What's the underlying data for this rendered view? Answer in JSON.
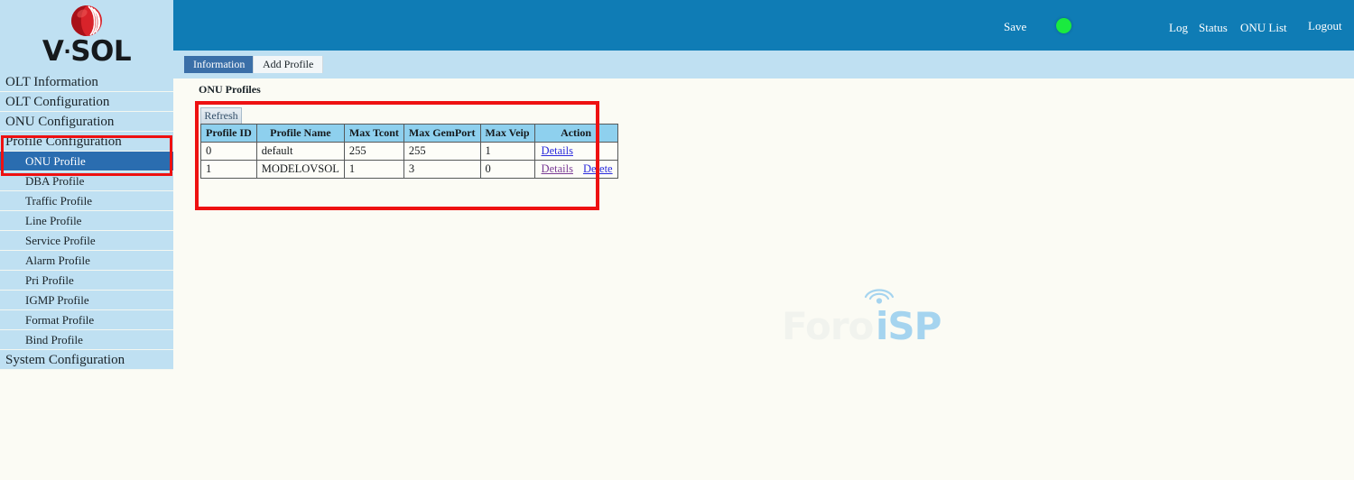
{
  "brand": {
    "logo_text_v": "V",
    "logo_text_dot": "·",
    "logo_text_sol": "SOL",
    "logo_icon": "vsol-sphere-logo",
    "logo_color": "#d8232a"
  },
  "topbar": {
    "background": "#0f7cb5",
    "save_label": "Save",
    "status_led": "green-status-led",
    "status_led_color": "#1aea3f",
    "log_label": "Log",
    "status_label": "Status",
    "onu_list_label": "ONU List",
    "logout_label": "Logout"
  },
  "tabs": [
    {
      "label": "Information",
      "active": true
    },
    {
      "label": "Add Profile",
      "active": false
    }
  ],
  "sidebar": {
    "items": [
      {
        "label": "OLT Information",
        "level": "top",
        "active": false
      },
      {
        "label": "OLT Configuration",
        "level": "top",
        "active": false
      },
      {
        "label": "ONU Configuration",
        "level": "top",
        "active": false
      },
      {
        "label": "Profile Configuration",
        "level": "top",
        "active": false
      },
      {
        "label": "ONU Profile",
        "level": "sub",
        "active": true
      },
      {
        "label": "DBA Profile",
        "level": "sub",
        "active": false
      },
      {
        "label": "Traffic Profile",
        "level": "sub",
        "active": false
      },
      {
        "label": "Line Profile",
        "level": "sub",
        "active": false
      },
      {
        "label": "Service Profile",
        "level": "sub",
        "active": false
      },
      {
        "label": "Alarm Profile",
        "level": "sub",
        "active": false
      },
      {
        "label": "Pri Profile",
        "level": "sub",
        "active": false
      },
      {
        "label": "IGMP Profile",
        "level": "sub",
        "active": false
      },
      {
        "label": "Format Profile",
        "level": "sub",
        "active": false
      },
      {
        "label": "Bind Profile",
        "level": "sub",
        "active": false
      },
      {
        "label": "System Configuration",
        "level": "top",
        "active": false
      }
    ]
  },
  "content": {
    "page_title": "ONU Profiles",
    "refresh_label": "Refresh",
    "table": {
      "headers": [
        "Profile ID",
        "Profile Name",
        "Max Tcont",
        "Max GemPort",
        "Max Veip",
        "Action"
      ],
      "rows": [
        {
          "profile_id": "0",
          "profile_name": "default",
          "max_tcont": "255",
          "max_gemport": "255",
          "max_veip": "1",
          "actions": [
            {
              "label": "Details",
              "state": "unvisited"
            }
          ]
        },
        {
          "profile_id": "1",
          "profile_name": "MODELOVSOL",
          "max_tcont": "1",
          "max_gemport": "3",
          "max_veip": "0",
          "actions": [
            {
              "label": "Details",
              "state": "visited"
            },
            {
              "label": "Delete",
              "state": "unvisited"
            }
          ]
        }
      ]
    }
  },
  "annotations": {
    "highlight_color": "#ee1111",
    "sidebar_box": "red-box-around-profile-configuration",
    "table_box": "red-box-around-onu-profiles-table"
  },
  "watermark": {
    "text_light": "Foro",
    "text_blue": "iSP",
    "icon": "broadcast-tower-icon",
    "color_light": "#f1f3ee",
    "color_blue": "#a5d4ef"
  }
}
